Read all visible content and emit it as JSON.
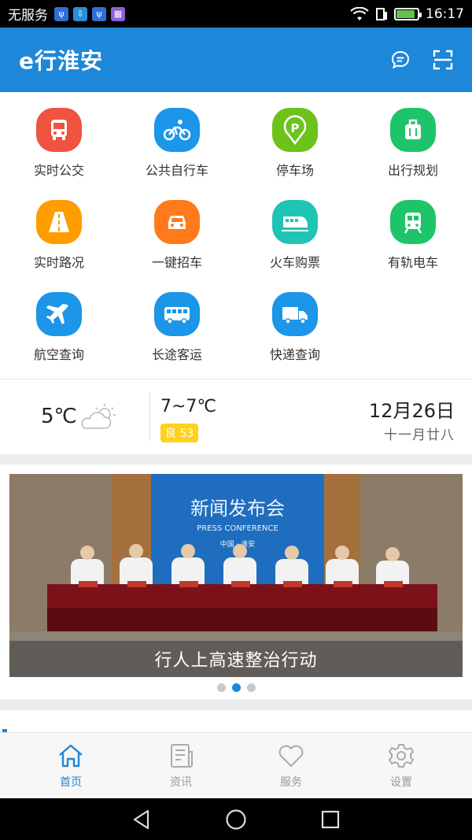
{
  "status_bar": {
    "carrier": "无服务",
    "time": "16:17",
    "notification_icons": [
      "usb-icon",
      "download-icon",
      "usb-icon",
      "keyboard-icon"
    ],
    "battery_level": 0.9
  },
  "header": {
    "title": "e行淮安",
    "actions": [
      "message-icon",
      "scan-icon"
    ]
  },
  "grid": {
    "items": [
      {
        "label": "实时公交",
        "icon": "bus-icon",
        "color": "#f0533f"
      },
      {
        "label": "公共自行车",
        "icon": "bicycle-icon",
        "color": "#1b96e8"
      },
      {
        "label": "停车场",
        "icon": "parking-icon",
        "color": "#6dc21c"
      },
      {
        "label": "出行规划",
        "icon": "luggage-icon",
        "color": "#1ec46a"
      },
      {
        "label": "实时路况",
        "icon": "road-icon",
        "color": "#ff9c00"
      },
      {
        "label": "一键招车",
        "icon": "taxi-icon",
        "color": "#ff7a1a"
      },
      {
        "label": "火车购票",
        "icon": "train-icon",
        "color": "#1fc4b5"
      },
      {
        "label": "有轨电车",
        "icon": "tram-icon",
        "color": "#1ec46a"
      },
      {
        "label": "航空查询",
        "icon": "airplane-icon",
        "color": "#1b96e8"
      },
      {
        "label": "长途客运",
        "icon": "coach-icon",
        "color": "#1b96e8"
      },
      {
        "label": "快递查询",
        "icon": "delivery-truck-icon",
        "color": "#1b96e8"
      }
    ]
  },
  "weather": {
    "current_temp": "5℃",
    "condition_icon": "partly-cloudy-icon",
    "range": "7~7℃",
    "aqi_label": "良 53",
    "aqi_color": "#ffd11a",
    "date": "12月26日",
    "lunar_date": "十一月廿八"
  },
  "banner": {
    "caption": "行人上高速整治行动",
    "backdrop_title": "新闻发布会",
    "backdrop_subtitle": "PRESS CONFERENCE",
    "backdrop_location": "中国 · 淮安",
    "slide_count": 3,
    "active_slide": 2
  },
  "bottom_nav": {
    "tabs": [
      {
        "label": "首页",
        "icon": "home-icon",
        "active": true
      },
      {
        "label": "资讯",
        "icon": "news-icon",
        "active": false
      },
      {
        "label": "服务",
        "icon": "heart-icon",
        "active": false
      },
      {
        "label": "设置",
        "icon": "settings-icon",
        "active": false
      }
    ]
  },
  "system_nav": [
    "back-icon",
    "home-circle-icon",
    "recents-icon"
  ],
  "colors": {
    "primary": "#1d87d9",
    "inactive": "#999999"
  }
}
